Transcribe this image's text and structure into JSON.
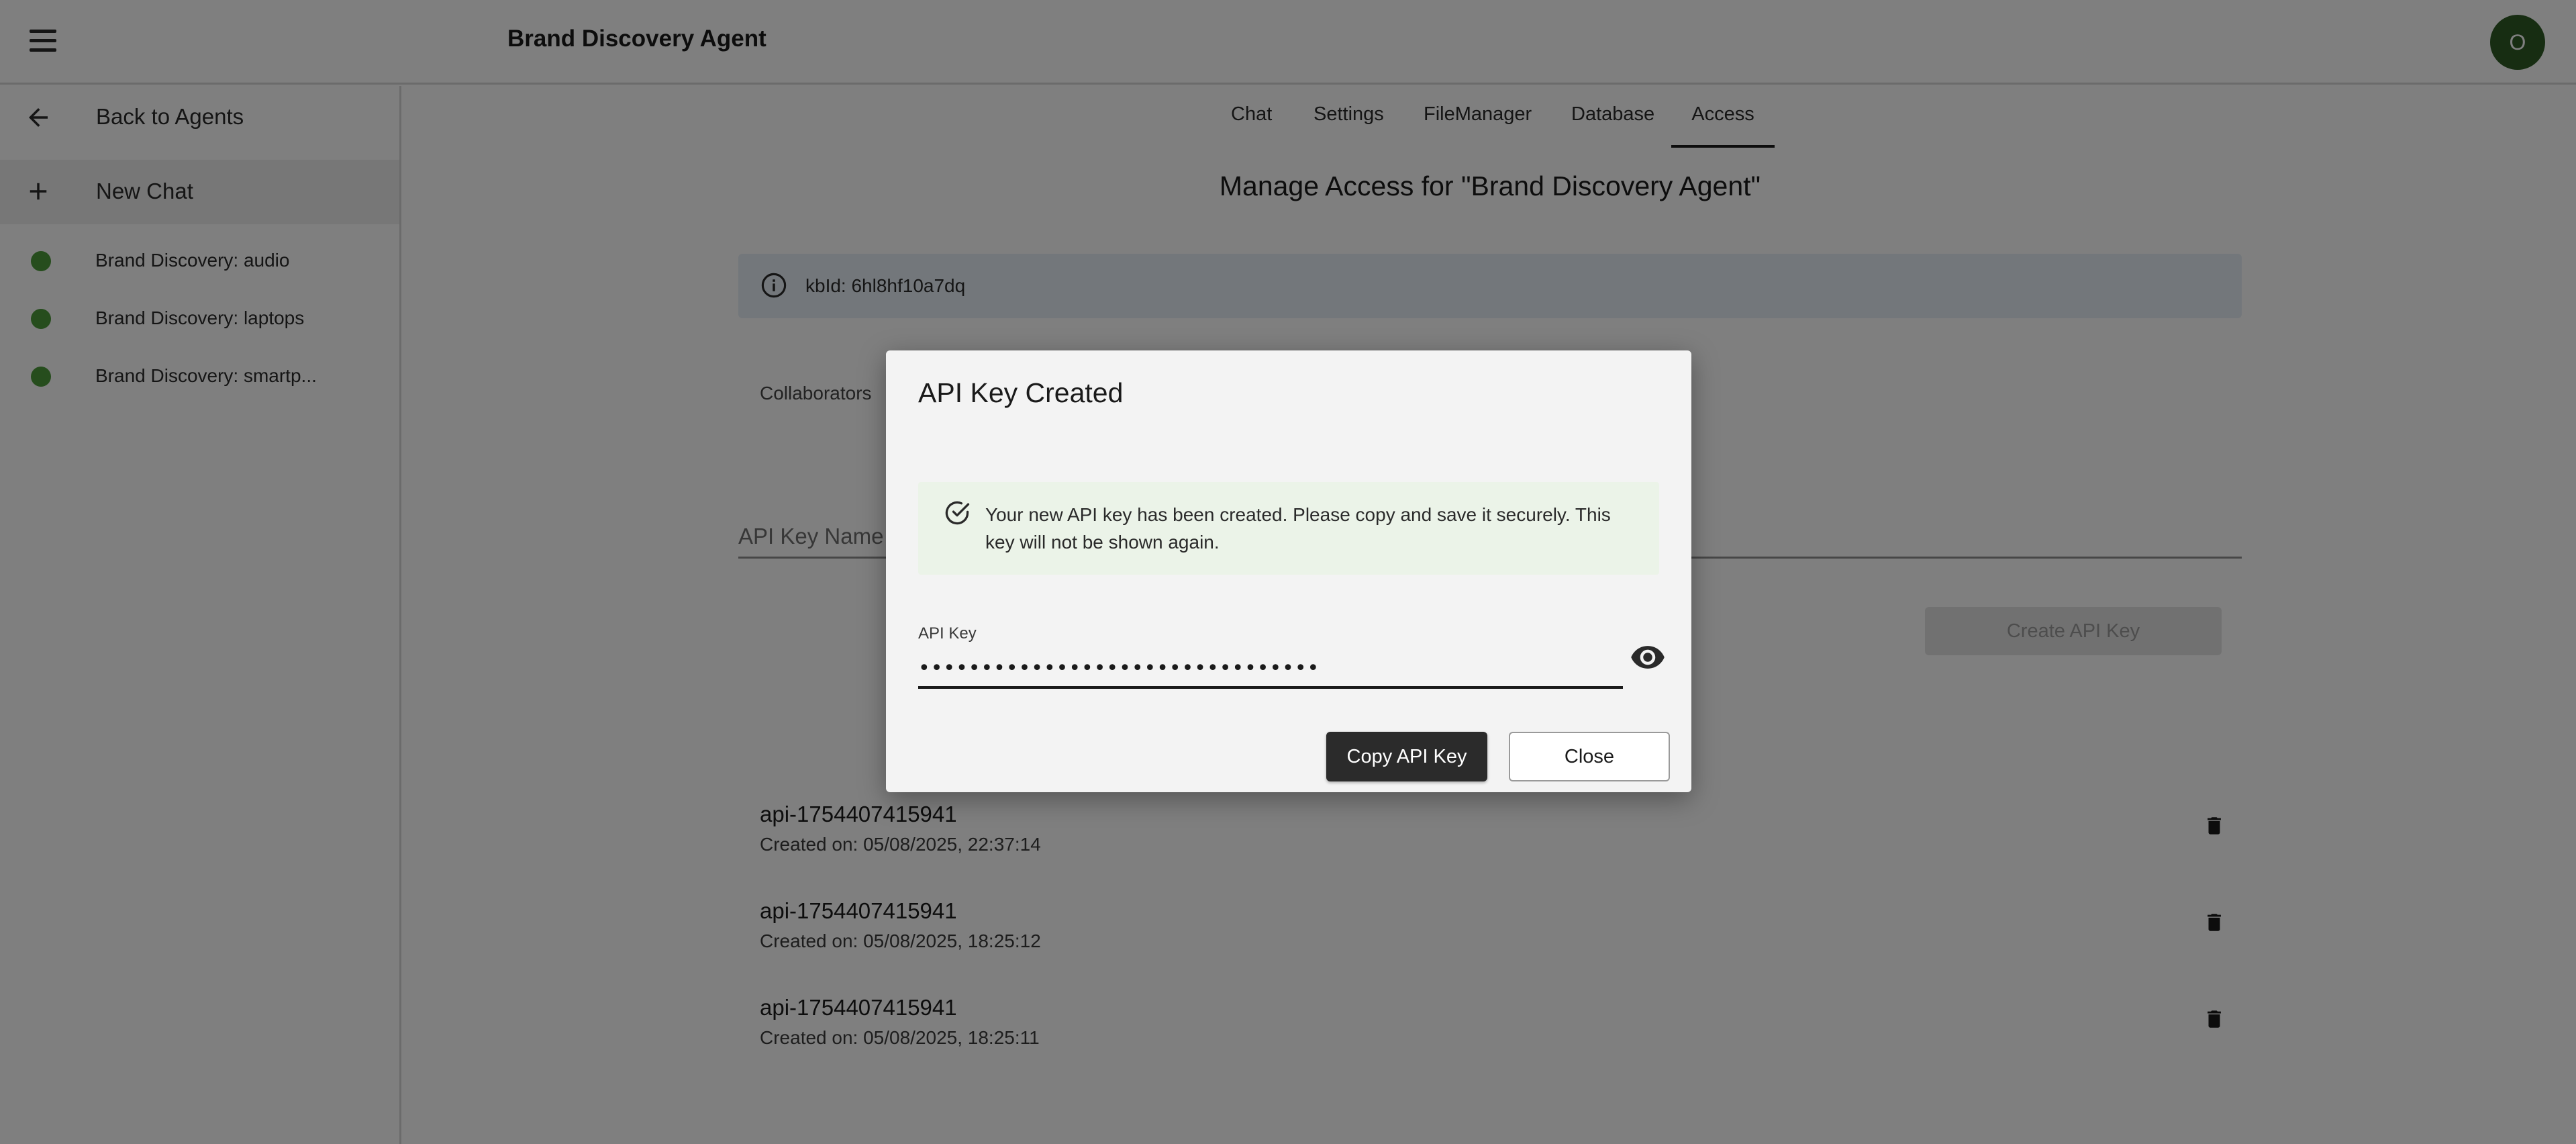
{
  "app": {
    "title": "Brand Discovery Agent",
    "avatar_initial": "O",
    "menu_icon": "hamburger-menu-icon"
  },
  "sidebar": {
    "back_label": "Back to Agents",
    "new_chat_label": "New Chat",
    "chats": [
      {
        "label": "Brand Discovery: audio",
        "status_color": "#4c9a3a"
      },
      {
        "label": "Brand Discovery: laptops",
        "status_color": "#4c9a3a"
      },
      {
        "label": "Brand Discovery: smartp...",
        "status_color": "#4c9a3a"
      }
    ]
  },
  "tabs": [
    {
      "label": "Chat",
      "active": false
    },
    {
      "label": "Settings",
      "active": false
    },
    {
      "label": "FileManager",
      "active": false
    },
    {
      "label": "Database",
      "active": false
    },
    {
      "label": "Access",
      "active": true
    }
  ],
  "main": {
    "heading": "Manage Access for \"Brand Discovery Agent\"",
    "info_text": "kbId: 6hl8hf10a7dq",
    "collaborators_label": "Collaborators",
    "api_key_name_placeholder": "API Key Name",
    "create_button_label": "Create API Key",
    "keys": [
      {
        "name": "api-1754407415941",
        "created": "Created on: 05/08/2025, 22:37:14"
      },
      {
        "name": "api-1754407415941",
        "created": "Created on: 05/08/2025, 18:25:12"
      },
      {
        "name": "api-1754407415941",
        "created": "Created on: 05/08/2025, 18:25:11"
      }
    ]
  },
  "dialog": {
    "title": "API Key Created",
    "success_message": "Your new API key has been created. Please copy and save it securely. This key will not be shown again.",
    "field_label": "API Key",
    "masked_value": "••••••••••••••••••••••••••••••••",
    "copy_button_label": "Copy API Key",
    "close_button_label": "Close"
  },
  "colors": {
    "accent_dark": "#2b2b2b",
    "status_green": "#4c9a3a",
    "avatar_bg": "#2f5a25"
  }
}
